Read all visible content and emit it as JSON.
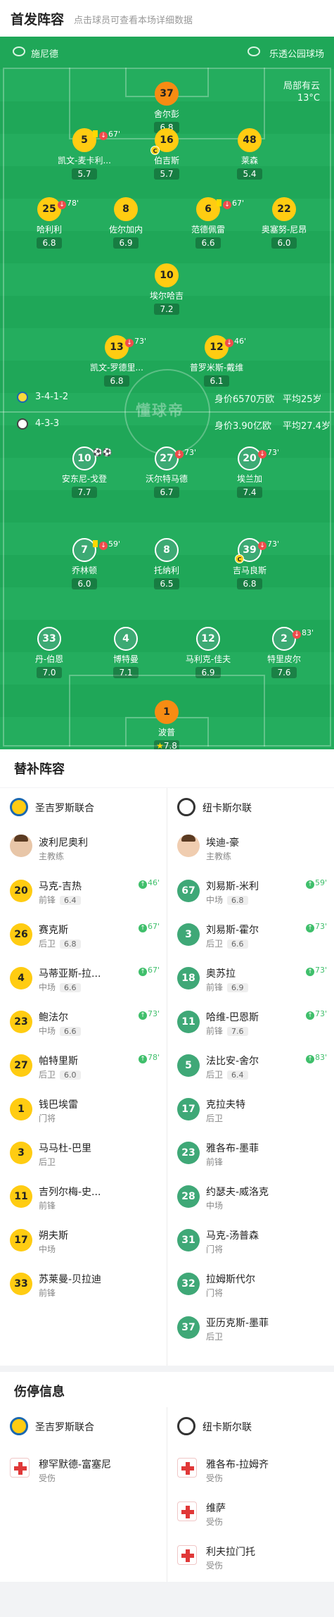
{
  "header": {
    "title": "首发阵容",
    "subtitle": "点击球员可查看本场详细数据"
  },
  "pitch": {
    "home_team": "施尼德",
    "away_team": "乐透公园球场",
    "weather": "局部有云",
    "temperature": "13°C",
    "watermark": "懂球帝",
    "home_formation": "3-4-1-2",
    "home_value": "身价6570万欧",
    "home_age": "平均25岁",
    "away_formation": "4-3-3",
    "away_value": "身价3.90亿欧",
    "away_age": "平均27.4岁"
  },
  "home_players": [
    {
      "num": "37",
      "name": "舍尔彭",
      "rating": "6.8",
      "events": ""
    },
    {
      "num": "5",
      "name": "凯文-麦卡利...",
      "rating": "5.7",
      "events": "67'",
      "yellow": true,
      "subout": true
    },
    {
      "num": "16",
      "name": "伯吉斯",
      "rating": "5.7",
      "events": "",
      "captain": "C"
    },
    {
      "num": "48",
      "name": "莱森",
      "rating": "5.4",
      "events": ""
    },
    {
      "num": "25",
      "name": "哈利利",
      "rating": "6.8",
      "events": "78'",
      "subout": true
    },
    {
      "num": "8",
      "name": "佐尔加内",
      "rating": "6.9",
      "events": ""
    },
    {
      "num": "6",
      "name": "范德佩雷",
      "rating": "6.6",
      "events": "67'",
      "yellow": true,
      "subout": true
    },
    {
      "num": "22",
      "name": "奥塞努-尼昂",
      "rating": "6.0",
      "events": ""
    },
    {
      "num": "10",
      "name": "埃尔哈吉",
      "rating": "7.2",
      "events": ""
    },
    {
      "num": "13",
      "name": "凯文-罗德里...",
      "rating": "6.8",
      "events": "73'",
      "subout": true
    },
    {
      "num": "12",
      "name": "普罗米斯-戴维",
      "rating": "6.1",
      "events": "46'",
      "subout": true
    }
  ],
  "away_players": [
    {
      "num": "10",
      "name": "安东尼-戈登",
      "rating": "7.7",
      "events": "⚽⚽"
    },
    {
      "num": "27",
      "name": "沃尔特马德",
      "rating": "6.7",
      "events": "73'",
      "subout": true
    },
    {
      "num": "20",
      "name": "埃兰加",
      "rating": "7.4",
      "events": "73'",
      "subout": true
    },
    {
      "num": "7",
      "name": "乔林顿",
      "rating": "6.0",
      "events": "59'",
      "yellow": true,
      "subout": true
    },
    {
      "num": "8",
      "name": "托纳利",
      "rating": "6.5",
      "events": ""
    },
    {
      "num": "39",
      "name": "吉马良斯",
      "rating": "6.8",
      "events": "73'",
      "subout": true,
      "captain": "C"
    },
    {
      "num": "33",
      "name": "丹-伯恩",
      "rating": "7.0",
      "events": ""
    },
    {
      "num": "4",
      "name": "博特曼",
      "rating": "7.1",
      "events": ""
    },
    {
      "num": "12",
      "name": "马利克-佳夫",
      "rating": "6.9",
      "events": ""
    },
    {
      "num": "2",
      "name": "特里皮尔",
      "rating": "7.6",
      "events": "83'",
      "subout": true
    },
    {
      "num": "1",
      "name": "波普",
      "rating": "7.8",
      "events": "",
      "star": "★"
    }
  ],
  "subs": {
    "title": "替补阵容",
    "home_team": "圣吉罗斯联合",
    "away_team": "纽卡斯尔联",
    "home_coach": {
      "name": "波利尼奥利",
      "role": "主教练"
    },
    "away_coach": {
      "name": "埃迪-豪",
      "role": "主教练"
    },
    "home": [
      {
        "num": "20",
        "name": "马克-吉热",
        "pos": "前锋",
        "rating": "6.4",
        "ev": "46'"
      },
      {
        "num": "26",
        "name": "赛克斯",
        "pos": "后卫",
        "rating": "6.8",
        "ev": "67'"
      },
      {
        "num": "4",
        "name": "马蒂亚斯-拉...",
        "pos": "中场",
        "rating": "6.6",
        "ev": "67'"
      },
      {
        "num": "23",
        "name": "鲍法尔",
        "pos": "中场",
        "rating": "6.6",
        "ev": "73'"
      },
      {
        "num": "27",
        "name": "帕特里斯",
        "pos": "后卫",
        "rating": "6.0",
        "ev": "78'"
      },
      {
        "num": "1",
        "name": "钱巴埃雷",
        "pos": "门将",
        "rating": "",
        "ev": ""
      },
      {
        "num": "3",
        "name": "马马杜-巴里",
        "pos": "后卫",
        "rating": "",
        "ev": ""
      },
      {
        "num": "11",
        "name": "吉列尔梅-史...",
        "pos": "前锋",
        "rating": "",
        "ev": ""
      },
      {
        "num": "17",
        "name": "朔夫斯",
        "pos": "中场",
        "rating": "",
        "ev": ""
      },
      {
        "num": "33",
        "name": "苏莱曼-贝拉迪",
        "pos": "前锋",
        "rating": "",
        "ev": ""
      }
    ],
    "away": [
      {
        "num": "67",
        "name": "刘易斯-米利",
        "pos": "中场",
        "rating": "6.8",
        "ev": "59'"
      },
      {
        "num": "3",
        "name": "刘易斯-霍尔",
        "pos": "后卫",
        "rating": "6.6",
        "ev": "73'"
      },
      {
        "num": "18",
        "name": "奥苏拉",
        "pos": "前锋",
        "rating": "6.9",
        "ev": "73'"
      },
      {
        "num": "11",
        "name": "哈维-巴恩斯",
        "pos": "前锋",
        "rating": "7.6",
        "ev": "73'"
      },
      {
        "num": "5",
        "name": "法比安-舍尔",
        "pos": "后卫",
        "rating": "6.4",
        "ev": "83'"
      },
      {
        "num": "17",
        "name": "克拉夫特",
        "pos": "后卫",
        "rating": "",
        "ev": ""
      },
      {
        "num": "23",
        "name": "雅各布-墨菲",
        "pos": "前锋",
        "rating": "",
        "ev": ""
      },
      {
        "num": "28",
        "name": "约瑟夫-威洛克",
        "pos": "中场",
        "rating": "",
        "ev": ""
      },
      {
        "num": "31",
        "name": "马克-汤普森",
        "pos": "门将",
        "rating": "",
        "ev": ""
      },
      {
        "num": "32",
        "name": "拉姆斯代尔",
        "pos": "门将",
        "rating": "",
        "ev": ""
      },
      {
        "num": "37",
        "name": "亚历克斯-墨菲",
        "pos": "后卫",
        "rating": "",
        "ev": ""
      }
    ]
  },
  "injuries": {
    "title": "伤停信息",
    "home_team": "圣吉罗斯联合",
    "away_team": "纽卡斯尔联",
    "home": [
      {
        "name": "穆罕默德-富塞尼",
        "status": "受伤"
      }
    ],
    "away": [
      {
        "name": "雅各布-拉姆齐",
        "status": "受伤"
      },
      {
        "name": "维萨",
        "status": "受伤"
      },
      {
        "name": "利夫拉门托",
        "status": "受伤"
      }
    ]
  },
  "colors": {
    "pitch": "#1fa758",
    "home_kit": "#ffcc12",
    "away_kit": "#3daa74",
    "gk": "#f78c13"
  }
}
